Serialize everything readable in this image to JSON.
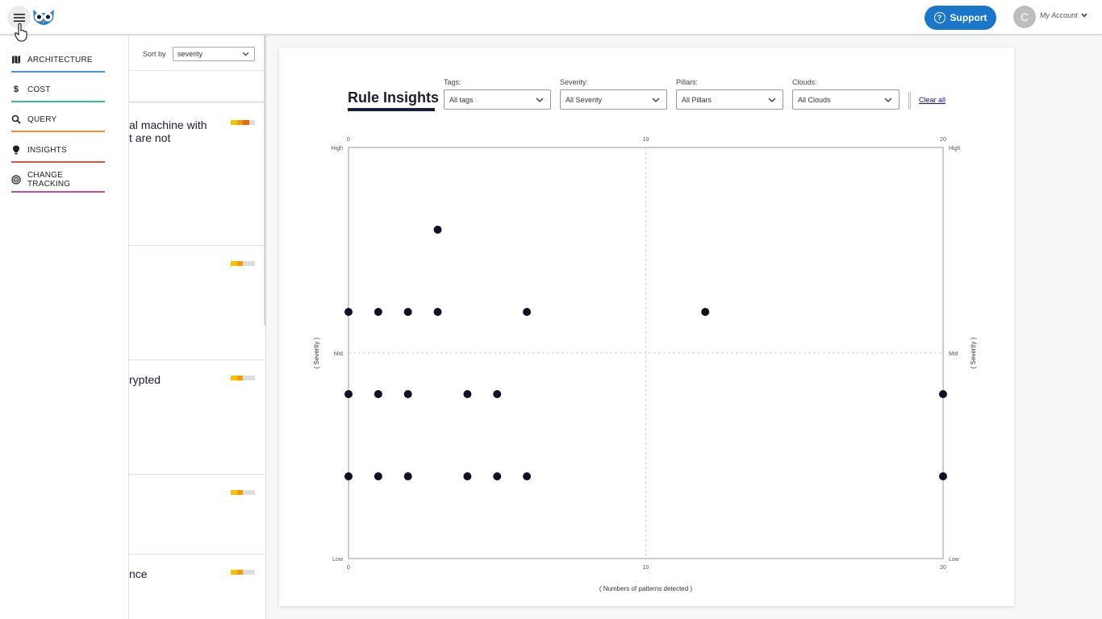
{
  "header": {
    "support_label": "Support",
    "avatar_initial": "C",
    "account_label": "My Account"
  },
  "sidenav": {
    "items": [
      {
        "label": "ARCHITECTURE",
        "icon": "map-icon",
        "color": "#4a90d9"
      },
      {
        "label": "COST",
        "icon": "dollar-icon",
        "color": "#3cb8a0"
      },
      {
        "label": "QUERY",
        "icon": "search-icon",
        "color": "#e69138"
      },
      {
        "label": "INSIGHTS",
        "icon": "lightbulb-icon",
        "color": "#d9534f"
      },
      {
        "label": "CHANGE TRACKING",
        "icon": "radar-icon",
        "color": "#c94f9c"
      }
    ]
  },
  "listpanel": {
    "sort_label": "Sort by",
    "sort_value": "severity",
    "cards": [
      {
        "text_line1": "al machine with",
        "text_line2": "t are not",
        "severity": 0.75
      },
      {
        "text_line1": "",
        "text_line2": "",
        "severity": 0.5
      },
      {
        "text_line1": "rypted",
        "text_line2": "",
        "severity": 0.5
      },
      {
        "text_line1": "",
        "text_line2": "",
        "severity": 0.5
      },
      {
        "text_line1": "nce",
        "text_line2": "",
        "severity": 0.5
      }
    ]
  },
  "insights": {
    "title": "Rule Insights",
    "filters": [
      {
        "label": "Tags:",
        "value": "All tags"
      },
      {
        "label": "Severity:",
        "value": "All Severity"
      },
      {
        "label": "Pillars:",
        "value": "All Pillars"
      },
      {
        "label": "Clouds:",
        "value": "All Clouds"
      }
    ],
    "clear_all": "Clear all"
  },
  "chart_data": {
    "type": "scatter",
    "title": "",
    "xlabel": "( Numbers of patterns detected )",
    "ylabel": "( Severity )",
    "xlim": [
      0,
      20
    ],
    "ylim": [
      0,
      10
    ],
    "x_ticks": [
      0,
      10,
      20
    ],
    "y_tick_labels": [
      {
        "value": 10,
        "label": "High"
      },
      {
        "value": 5,
        "label": "Mid"
      },
      {
        "value": 0,
        "label": "Low"
      }
    ],
    "grid": "center dashed lines",
    "point_color": "#0f1124",
    "points": [
      {
        "x": 3,
        "y": 8
      },
      {
        "x": 0,
        "y": 6
      },
      {
        "x": 1,
        "y": 6
      },
      {
        "x": 2,
        "y": 6
      },
      {
        "x": 3,
        "y": 6
      },
      {
        "x": 6,
        "y": 6
      },
      {
        "x": 12,
        "y": 6
      },
      {
        "x": 0,
        "y": 4
      },
      {
        "x": 1,
        "y": 4
      },
      {
        "x": 2,
        "y": 4
      },
      {
        "x": 4,
        "y": 4
      },
      {
        "x": 5,
        "y": 4
      },
      {
        "x": 20,
        "y": 4
      },
      {
        "x": 0,
        "y": 2
      },
      {
        "x": 1,
        "y": 2
      },
      {
        "x": 2,
        "y": 2
      },
      {
        "x": 4,
        "y": 2
      },
      {
        "x": 5,
        "y": 2
      },
      {
        "x": 6,
        "y": 2
      },
      {
        "x": 20,
        "y": 2
      }
    ]
  }
}
